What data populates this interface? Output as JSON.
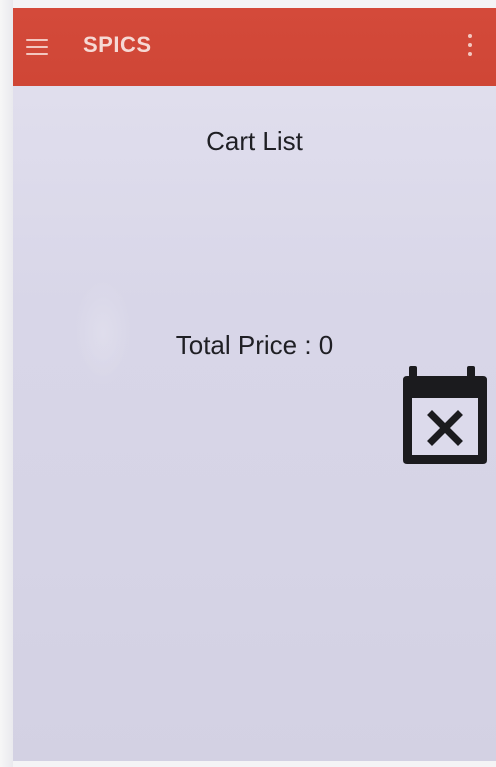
{
  "app_bar": {
    "title": "SPICS",
    "menu_icon": "hamburger-menu-icon",
    "overflow_icon": "more-vertical-icon",
    "color": "#d44a3a"
  },
  "main": {
    "heading": "Cart List",
    "total_price": "Total Price : 0",
    "clear_cart_icon": "calendar-remove-icon"
  }
}
